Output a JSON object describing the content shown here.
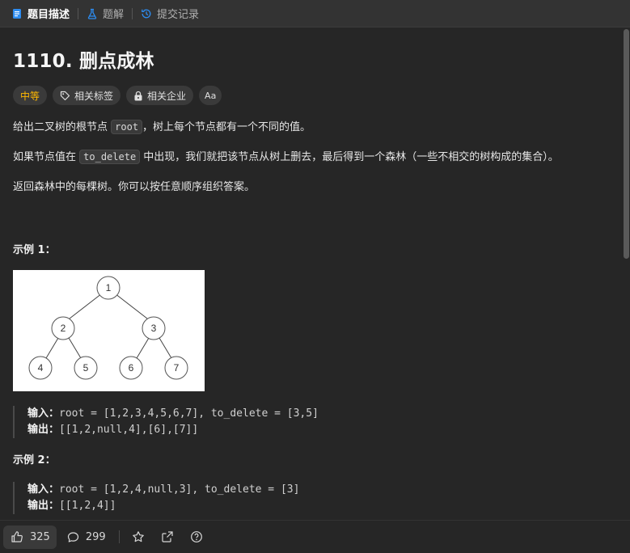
{
  "tabs": [
    {
      "label": "题目描述",
      "icon": "description-icon",
      "active": true
    },
    {
      "label": "题解",
      "icon": "flask-icon",
      "active": false
    },
    {
      "label": "提交记录",
      "icon": "history-icon",
      "active": false
    }
  ],
  "problem": {
    "title": "1110. 删点成林",
    "difficulty": "中等",
    "tags": [
      "相关标签",
      "相关企业",
      "Aa"
    ],
    "p1": {
      "before": "给出二叉树的根节点 ",
      "code": "root",
      "after": "，树上每个节点都有一个不同的值。"
    },
    "p2": {
      "before": "如果节点值在 ",
      "code": "to_delete",
      "after": " 中出现，我们就把该节点从树上删去，最后得到一个森林（一些不相交的树构成的集合）。"
    },
    "p3": "返回森林中的每棵树。你可以按任意顺序组织答案。"
  },
  "examples": [
    {
      "title": "示例 1：",
      "input_label": "输入：",
      "input": "root = [1,2,3,4,5,6,7], to_delete = [3,5]",
      "output_label": "输出：",
      "output": "[[1,2,null,4],[6],[7]]",
      "tree_nodes": [
        "1",
        "2",
        "3",
        "4",
        "5",
        "6",
        "7"
      ]
    },
    {
      "title": "示例 2：",
      "input_label": "输入：",
      "input": "root = [1,2,4,null,3], to_delete = [3]",
      "output_label": "输出：",
      "output": "[[1,2,4]]"
    }
  ],
  "footer": {
    "likes": "325",
    "comments": "299"
  },
  "colors": {
    "difficulty": "#ffb800",
    "active_tab_icon": "#2d8cf0",
    "background": "#262626"
  }
}
